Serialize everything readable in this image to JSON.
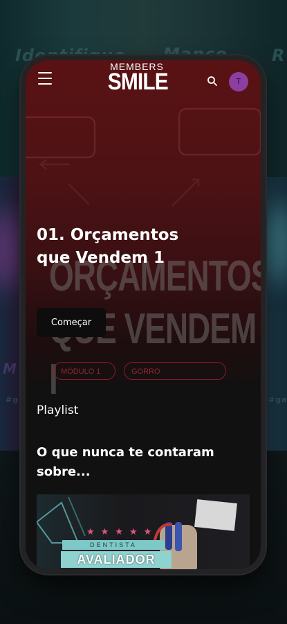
{
  "app": {
    "logo_top": "MEMBERS",
    "logo_main": "SMILE",
    "avatar_initial": "T"
  },
  "hero": {
    "course_title": "01. Orçamentos que Vendem 1",
    "start_button": "Começar",
    "cover_word_1": "ORÇAMENTOS",
    "cover_word_2": "QUE VENDEM I",
    "chip_module": "MÓDULO 1",
    "chip_gorro": "GORRO"
  },
  "playlist": {
    "label": "Playlist",
    "video_title": "O que nunca te contaram sobre...",
    "thumb_tag": "DENTISTA",
    "thumb_main": "AVALIADOR"
  },
  "background": {
    "words": [
      "Identifique",
      "Manco",
      "R",
      "#gi",
      "#gam",
      "M"
    ]
  },
  "colors": {
    "accent": "#8c3fa0",
    "hero_red": "#5a1214",
    "chip_border": "#8e1d24",
    "thumb_cyan": "#8fd3d1"
  },
  "icons": {
    "menu": "hamburger-icon",
    "search": "search-icon"
  }
}
